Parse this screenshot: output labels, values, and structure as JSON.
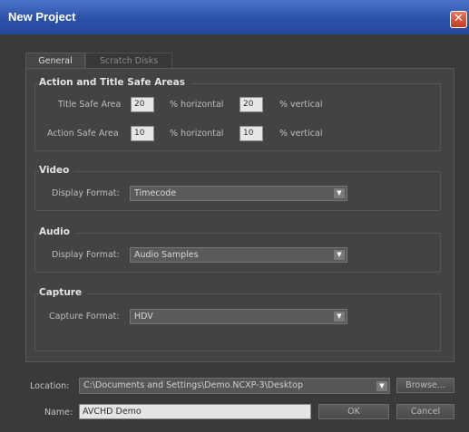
{
  "window": {
    "title": "New Project",
    "close_glyph": "✕"
  },
  "tabs": [
    {
      "label": "General",
      "active": true
    },
    {
      "label": "Scratch Disks",
      "active": false
    }
  ],
  "safe_areas": {
    "heading": "Action and Title Safe Areas",
    "title_label": "Title Safe Area",
    "title_horizontal": "20",
    "title_vertical": "20",
    "action_label": "Action Safe Area",
    "action_horizontal": "10",
    "action_vertical": "10",
    "horizontal_suffix": "% horizontal",
    "vertical_suffix": "% vertical"
  },
  "video": {
    "heading": "Video",
    "label": "Display Format:",
    "value": "Timecode"
  },
  "audio": {
    "heading": "Audio",
    "label": "Display Format:",
    "value": "Audio Samples"
  },
  "capture": {
    "heading": "Capture",
    "label": "Capture Format:",
    "value": "HDV"
  },
  "location": {
    "label": "Location:",
    "value": "C:\\Documents and Settings\\Demo.NCXP-3\\Desktop",
    "browse_label": "Browse..."
  },
  "name": {
    "label": "Name:",
    "value": "AVCHD Demo"
  },
  "buttons": {
    "ok": "OK",
    "cancel": "Cancel"
  },
  "icons": {
    "dropdown": "chevron-down-icon",
    "close": "close-icon"
  },
  "colors": {
    "titlebar": "#2c52a8",
    "dialog_bg": "#3a3a3a",
    "close_button": "#c43b1d"
  }
}
